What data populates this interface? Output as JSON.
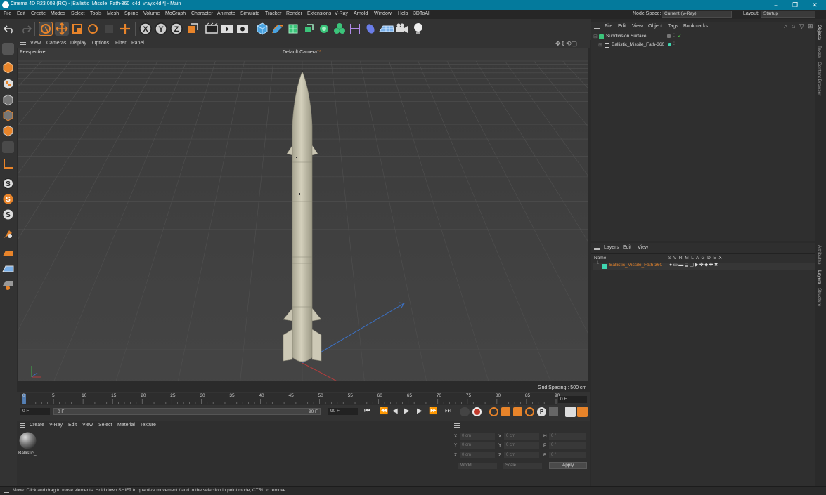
{
  "window": {
    "title": "Cinema 4D R23.008 (RC) - [Ballistic_Missile_Fath-360_c4d_vray.c4d *] - Main",
    "minimize": "–",
    "maximize": "❐",
    "close": "✕"
  },
  "menu": [
    "File",
    "Edit",
    "Create",
    "Modes",
    "Select",
    "Tools",
    "Mesh",
    "Spline",
    "Volume",
    "MoGraph",
    "Character",
    "Animate",
    "Simulate",
    "Tracker",
    "Render",
    "Extensions",
    "V-Ray",
    "Arnold",
    "Window",
    "Help",
    "3DToAll"
  ],
  "node_space": {
    "label": "Node Space:",
    "value": "Current (V-Ray)"
  },
  "layout": {
    "label": "Layout:",
    "value": "Startup"
  },
  "viewport": {
    "menu": [
      "View",
      "Cameras",
      "Display",
      "Options",
      "Filter",
      "Panel"
    ],
    "name": "Perspective",
    "camera": "Default Camera",
    "camera_marker": "°*",
    "grid_spacing": "Grid Spacing : 500 cm"
  },
  "timeline": {
    "ticks": [
      "0",
      "5",
      "10",
      "15",
      "20",
      "25",
      "30",
      "35",
      "40",
      "45",
      "50",
      "55",
      "60",
      "65",
      "70",
      "75",
      "80",
      "85",
      "90"
    ],
    "current_frame": "0 F",
    "start_frame": "0 F",
    "range_start": "0 F",
    "range_end": "90 F",
    "end_frame": "90 F"
  },
  "material_manager": {
    "menu": [
      "Create",
      "V-Ray",
      "Edit",
      "View",
      "Select",
      "Material",
      "Texture"
    ],
    "materials": [
      {
        "name": "Ballistic_"
      }
    ]
  },
  "coordinates": {
    "header": [
      "--",
      "--",
      "--"
    ],
    "rows": [
      {
        "a": "X",
        "av": "0 cm",
        "b": "X",
        "bv": "0 cm",
        "c": "H",
        "cv": "0 °"
      },
      {
        "a": "Y",
        "av": "0 cm",
        "b": "Y",
        "bv": "0 cm",
        "c": "P",
        "cv": "0 °"
      },
      {
        "a": "Z",
        "av": "0 cm",
        "b": "Z",
        "bv": "0 cm",
        "c": "B",
        "cv": "0 °"
      }
    ],
    "mode": "World",
    "scale": "Scale",
    "apply": "Apply"
  },
  "object_manager": {
    "menu": [
      "File",
      "Edit",
      "View",
      "Object",
      "Tags",
      "Bookmarks"
    ],
    "objects": [
      {
        "name": "Subdivision Surface"
      },
      {
        "name": "Ballistic_Missile_Fath-360"
      }
    ]
  },
  "layer_manager": {
    "menu": [
      "Layers",
      "Edit",
      "View"
    ],
    "columns": {
      "name": "Name",
      "flags": "S  V  R  M  L  A  G  D  E  X"
    },
    "layers": [
      {
        "name": "Ballistic_Missile_Fath-360",
        "color": "#3fd6b0"
      }
    ]
  },
  "right_tabs": [
    "Objects",
    "Takes",
    "Content Browser",
    "Attributes",
    "Layers",
    "Structure"
  ],
  "status": "Move: Click and drag to move elements. Hold down SHIFT to quantize movement / add to the selection in point mode, CTRL to remove.",
  "colors": {
    "accent": "#047a9c",
    "layer_green": "#3fd6b0",
    "orange": "#e8842a",
    "missile": "#c8c4b0"
  }
}
